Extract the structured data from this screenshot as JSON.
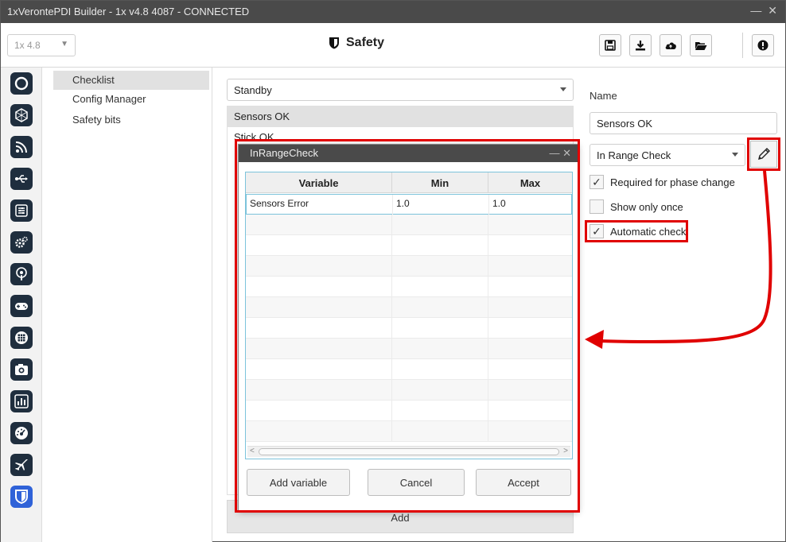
{
  "window": {
    "title": "1xVerontePDI Builder - 1x v4.8 4087 - CONNECTED",
    "controls": "— ✕"
  },
  "toolbar": {
    "version": "1x 4.8",
    "page_title": "Safety",
    "buttons": [
      "save-icon",
      "download-icon",
      "cloud-icon",
      "folder-icon",
      "info-icon"
    ]
  },
  "sidebar": {
    "icons": [
      "power-icon",
      "polygon-icon",
      "rss-icon",
      "usb-icon",
      "sliders-icon",
      "gears-icon",
      "podcast-icon",
      "gamepad-icon",
      "grid-icon",
      "camera-icon",
      "bar-chart-icon",
      "dashboard-icon",
      "plane-icon",
      "shield-icon"
    ]
  },
  "submenu": {
    "items": [
      "Checklist",
      "Config Manager",
      "Safety bits"
    ]
  },
  "center": {
    "phase": "Standby",
    "checklist": [
      "Sensors OK",
      "Stick OK"
    ],
    "add_label": "Add"
  },
  "right": {
    "name_label": "Name",
    "name_value": "Sensors OK",
    "check_type": "In Range Check",
    "checkboxes": [
      {
        "label": "Required for phase change",
        "checked": true
      },
      {
        "label": "Show only once",
        "checked": false
      },
      {
        "label": "Automatic check",
        "checked": true
      }
    ]
  },
  "dialog": {
    "title": "InRangeCheck",
    "controls": "— ✕",
    "columns": [
      "Variable",
      "Min",
      "Max"
    ],
    "rows": [
      [
        "Sensors Error",
        "1.0",
        "1.0"
      ]
    ],
    "buttons": {
      "add": "Add variable",
      "cancel": "Cancel",
      "accept": "Accept"
    }
  },
  "colors": {
    "highlight": "#e00000",
    "sidebar_icon": "#1f2e3e",
    "active_icon": "#2f62d8",
    "titlebar": "#4a4a4a"
  }
}
